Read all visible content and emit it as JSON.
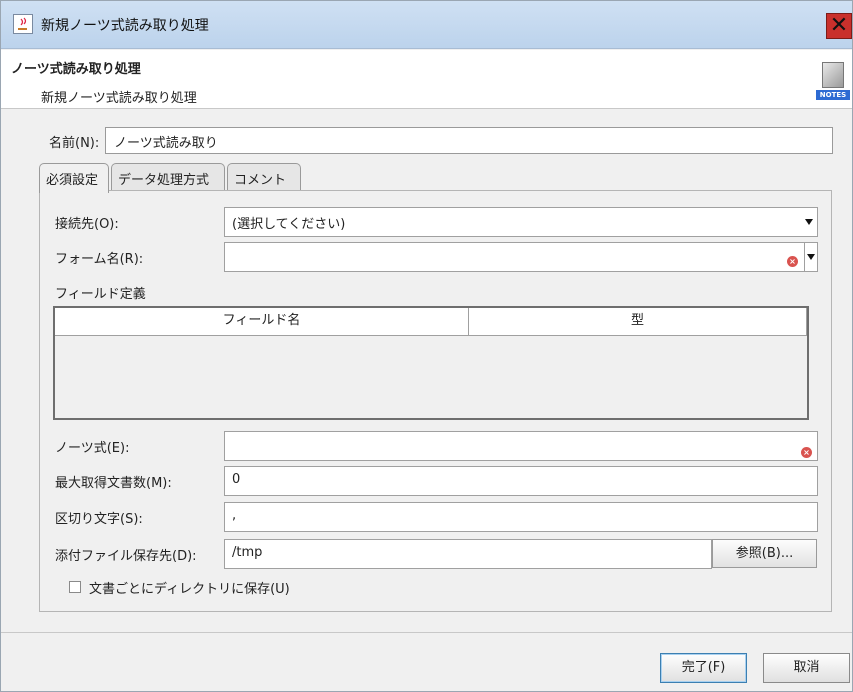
{
  "window": {
    "title": "新規ノーツ式読み取り処理",
    "close_glyph": "✕"
  },
  "header": {
    "title": "ノーツ式読み取り処理",
    "subtitle": "新規ノーツ式読み取り処理",
    "icon_label": "NOTES"
  },
  "name_field": {
    "label": "名前(N):",
    "value": "ノーツ式読み取り"
  },
  "tabs": [
    {
      "label": "必須設定",
      "active": true
    },
    {
      "label": "データ処理方式",
      "active": false
    },
    {
      "label": "コメント",
      "active": false
    }
  ],
  "form": {
    "connection": {
      "label": "接続先(O):",
      "value": "(選択してください)"
    },
    "form_name": {
      "label": "フォーム名(R):",
      "value": ""
    },
    "field_def": {
      "label": "フィールド定義",
      "columns": [
        "フィールド名",
        "型"
      ]
    },
    "notes_formula": {
      "label": "ノーツ式(E):",
      "value": ""
    },
    "max_docs": {
      "label": "最大取得文書数(M):",
      "value": "0"
    },
    "delimiter": {
      "label": "区切り文字(S):",
      "value": ","
    },
    "attachment_dir": {
      "label": "添付ファイル保存先(D):",
      "value": "/tmp",
      "browse_label": "参照(B)..."
    },
    "save_per_doc": {
      "label": "文書ごとにディレクトリに保存(U)",
      "checked": false
    }
  },
  "footer": {
    "finish_label": "完了(F)",
    "cancel_label": "取消"
  },
  "colors": {
    "title_bar": "#bcd3ec",
    "close_button": "#c9302c",
    "error_icon": "#d9534f",
    "notes_badge": "#2d6bd3"
  }
}
